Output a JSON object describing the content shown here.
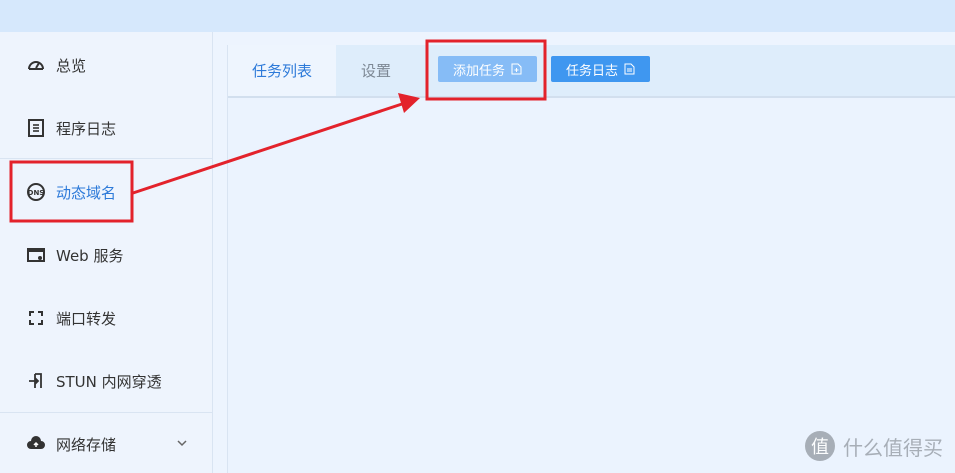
{
  "sidebar": {
    "items": [
      {
        "label": "总览",
        "icon": "dashboard-icon"
      },
      {
        "label": "程序日志",
        "icon": "log-document-icon"
      },
      {
        "label": "动态域名",
        "icon": "dns-icon",
        "active": true
      },
      {
        "label": "Web 服务",
        "icon": "web-window-icon"
      },
      {
        "label": "端口转发",
        "icon": "port-forward-icon"
      },
      {
        "label": "STUN 内网穿透",
        "icon": "stun-icon"
      },
      {
        "label": "网络存储",
        "icon": "cloud-upload-icon"
      }
    ]
  },
  "main": {
    "tabs": [
      {
        "label": "任务列表",
        "active": true
      },
      {
        "label": "设置"
      }
    ],
    "buttons": {
      "add_task": "添加任务",
      "task_log": "任务日志"
    }
  },
  "annotations": {
    "highlight_color": "#e3222b"
  },
  "watermark": {
    "text": "什么值得买",
    "logo_char": "值"
  },
  "colors": {
    "accent": "#2d7ad9",
    "button_primary": "#3f97f0",
    "button_light": "#86bcf6"
  }
}
